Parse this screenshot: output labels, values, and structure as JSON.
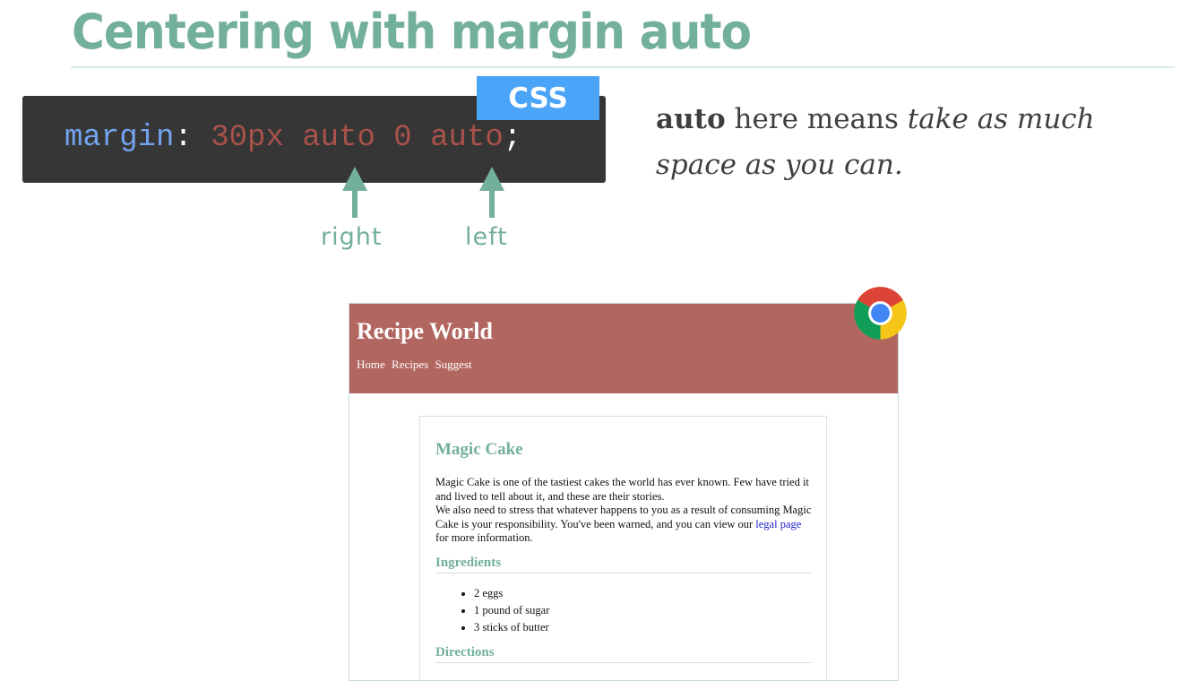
{
  "slide": {
    "title": "Centering with margin auto"
  },
  "code": {
    "property": "margin",
    "colon": ":",
    "v1": "30px",
    "v2": "auto",
    "v3": "0",
    "v4": "auto",
    "semicolon": ";",
    "badge": "CSS"
  },
  "annotations": {
    "right": "right",
    "left": "left"
  },
  "note": {
    "bold": "auto",
    "middle": " here means ",
    "italic": "take as much space as you can."
  },
  "browser": {
    "site_title": "Recipe World",
    "nav": [
      "Home",
      "Recipes",
      "Suggest"
    ],
    "article": {
      "title": "Magic Cake",
      "para1": "Magic Cake is one of the tastiest cakes the world has ever known. Few have tried it and lived to tell about it, and these are their stories.",
      "para2_before": "We also need to stress that whatever happens to you as a result of consuming Magic Cake is your responsibility. You've been warned, and you can view our",
      "link": "legal page",
      "para2_after": "for more information.",
      "ingredients_heading": "Ingredients",
      "ingredients": [
        "2 eggs",
        "1 pound of sugar",
        "3 sticks of butter"
      ],
      "directions_heading": "Directions"
    }
  },
  "colors": {
    "accent_green": "#73b09a",
    "code_bg": "#363636",
    "badge_blue": "#4aa4f8",
    "header_red": "#b26660",
    "code_property": "#73a3ee",
    "code_value": "#a9524a"
  },
  "icons": [
    "chrome-logo-icon",
    "arrow-up-icon",
    "arrow-right-icon",
    "arrow-left-icon"
  ]
}
